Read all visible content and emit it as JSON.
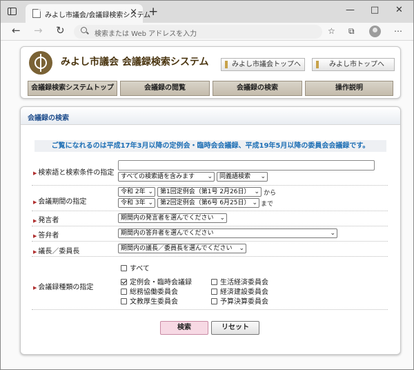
{
  "browser": {
    "tab_title": "みよし市議会/会議録検索システム",
    "tab_close": "×",
    "new_tab": "+",
    "address_placeholder": "検索または Web アドレスを入力",
    "win_minimize": "—",
    "win_maximize": "□",
    "win_close": "✕"
  },
  "header": {
    "site_title": "みよし市議会 会議録検索システム",
    "link_council_top": "みよし市議会トップへ",
    "link_city_top": "みよし市トップへ"
  },
  "menu": [
    {
      "label": "会議録検索システムトップ"
    },
    {
      "label": "会議録の閲覧"
    },
    {
      "label": "会議録の検索"
    },
    {
      "label": "操作説明"
    }
  ],
  "search": {
    "section_title": "会議録の検索",
    "notice": "ご覧になれるのは平成17年3月以降の定例会・臨時会会議録、平成19年5月以降の委員会会議録です。",
    "keyword": {
      "label": "検索語と検索条件の指定",
      "value": "",
      "condition": "すべての検索語を含みます",
      "synonym": "同義語検索"
    },
    "period": {
      "label": "会議期間の指定",
      "from_era": "令和 2年",
      "from_session": "第1回定例会（第1号 2月26日）",
      "from_suffix": "から",
      "to_era": "令和 3年",
      "to_session": "第2回定例会（第6号 6月25日）",
      "to_suffix": "まで"
    },
    "speaker": {
      "label": "発言者",
      "value": "期間内の発言者を選んでください"
    },
    "answerer": {
      "label": "答弁者",
      "value": "期間内の答弁者を選んでください"
    },
    "chair": {
      "label": "議長／委員長",
      "value": "期間内の議長／委員長を選んでください"
    },
    "types": {
      "label": "会議録種類の指定",
      "all_label": "すべて",
      "items": [
        {
          "label": "定例会・臨時会議録",
          "checked": true
        },
        {
          "label": "生活経済委員会",
          "checked": false
        },
        {
          "label": "総務協働委員会",
          "checked": false
        },
        {
          "label": "経済建設委員会",
          "checked": false
        },
        {
          "label": "文教厚生委員会",
          "checked": false
        },
        {
          "label": "予算決算委員会",
          "checked": false
        }
      ]
    },
    "search_button": "検索",
    "reset_button": "リセット"
  },
  "colors": {
    "title_brown": "#4a3510",
    "section_blue": "#1e4d8c",
    "notice_blue": "#1e6fb5",
    "search_button_pink": "#f7d9e4"
  }
}
